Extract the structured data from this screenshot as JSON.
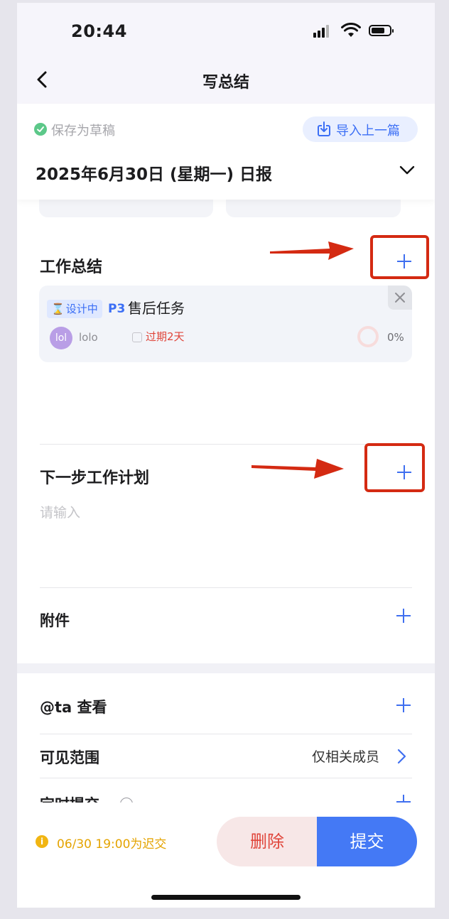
{
  "status_bar": {
    "time": "20:44",
    "battery_level": 0.75
  },
  "nav": {
    "title": "写总结"
  },
  "draft": {
    "status": "保存为草稿",
    "import_label": "导入上一篇"
  },
  "report": {
    "date_title": "2025年6月30日 (星期一) 日报"
  },
  "work_summary": {
    "title": "工作总结",
    "task": {
      "status": "设计中",
      "priority": "P3",
      "name": "售后任务",
      "avatar_text": "lol",
      "assignee": "lolo",
      "due": "过期2天",
      "progress": "0%"
    }
  },
  "next_plan": {
    "title": "下一步工作计划",
    "placeholder": "请输入"
  },
  "attachments": {
    "title": "附件"
  },
  "mention": {
    "title": "@ta 查看"
  },
  "visibility": {
    "title": "可见范围",
    "value": "仅相关成员"
  },
  "scheduled": {
    "title": "定时提交"
  },
  "footer": {
    "warning": "06/30 19:00为迟交",
    "delete_label": "删除",
    "submit_label": "提交"
  },
  "colors": {
    "accent": "#3f6ff0",
    "danger": "#e0453a",
    "warning": "#f1b512",
    "annotation": "#d42a12"
  }
}
